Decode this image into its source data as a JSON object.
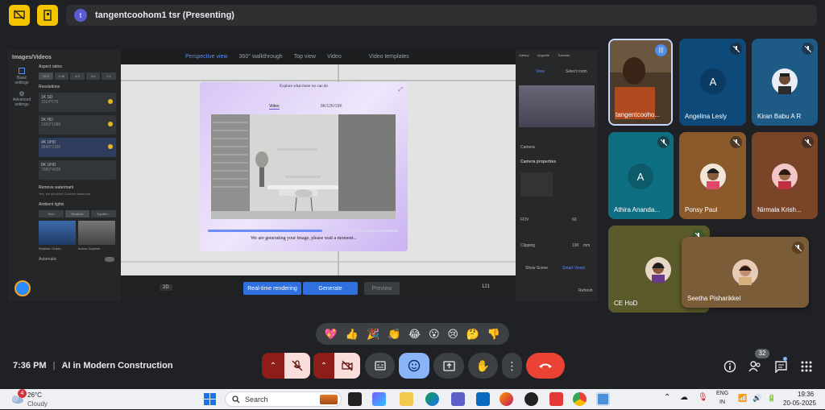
{
  "presenter": {
    "badge": "t",
    "text": "tangentcoohom1 tsr (Presenting)"
  },
  "shared_app": {
    "panel_title": "Images/Videos",
    "nav": [
      {
        "label": "Basic settings"
      },
      {
        "label": "Advanced settings"
      }
    ],
    "aspect_label": "Aspect ratios",
    "aspects": [
      "16:9",
      "9:16",
      "4:3",
      "3:4",
      "1:1"
    ],
    "resolution_label": "Resolutions",
    "resolutions": [
      {
        "name": "1K SD",
        "dims": "1024*576"
      },
      {
        "name": "2K HD",
        "dims": "1920*1080"
      },
      {
        "name": "4K UHD",
        "dims": "3840*2160"
      },
      {
        "name": "8K UHD",
        "dims": "7680*4320"
      }
    ],
    "watermark_label": "Remove watermark",
    "watermark_text": "Yes, we removed Coohom watermar",
    "ambient_label": "Ambient lights",
    "ambient_tabs": [
      "Tech",
      "Realistic",
      "Equilibr..."
    ],
    "thumb_labels": [
      "Realistic Outdo...",
      "Indoor Daytime..."
    ],
    "automatic_label": "Automatic",
    "view_tabs": [
      "Perspective view",
      "360° walkthrough",
      "Top view",
      "Video"
    ],
    "video_templates": "Video templates",
    "top_icons": [
      "Gallery",
      "Upgrade",
      "Tutorials"
    ],
    "right_tabs": [
      "View",
      "Select room"
    ],
    "camera_title": "Camera properties",
    "camera_label": "Camera",
    "fov_label": "FOV",
    "fov_value": "60",
    "clipping_label": "Clipping",
    "clipping_value": "100",
    "clipping_unit": "mm",
    "show_scene": "Show Scene",
    "smart_views": "Smart Views",
    "refresh": "Refresh",
    "bottom_left": "2D",
    "realtime_label": "Real-time rendering",
    "generate_label": "Generate",
    "preview_label": "Preview",
    "zoom": "121"
  },
  "modal": {
    "header": "Explore what more we can do",
    "tabs": [
      "Video",
      "8K/12K/16K"
    ],
    "progress": 0.6,
    "status": "We are generating your image, please wait a moment..."
  },
  "participants": [
    {
      "name": "tangentcooho...",
      "type": "video",
      "speaking": true
    },
    {
      "name": "Angelina Lesly",
      "type": "initial",
      "initial": "A",
      "muted": true
    },
    {
      "name": "Kiran Babu A R",
      "type": "photo",
      "muted": true
    },
    {
      "name": "Athira Ananda...",
      "type": "initial",
      "initial": "A",
      "muted": true
    },
    {
      "name": "Ponsy Paul",
      "type": "photo",
      "muted": true
    },
    {
      "name": "Nirmala Krish...",
      "type": "photo",
      "muted": true
    },
    {
      "name": "CE HoD",
      "type": "photo",
      "muted": true
    },
    {
      "name": "Seetha Pisharikkel",
      "type": "photo",
      "muted": true
    }
  ],
  "reactions": [
    "💖",
    "👍",
    "🎉",
    "👏",
    "😂",
    "😮",
    "😢",
    "🤔",
    "👎"
  ],
  "meeting": {
    "time": "7:36 PM",
    "separator": "|",
    "title": "AI in Modern Construction",
    "people_count": "32"
  },
  "colors": {
    "end_call": "#ea4335",
    "muted_bg": "#f9dedc",
    "accent": "#8ab4f8",
    "tile_blue": "#0d4a7a"
  },
  "taskbar": {
    "weather_temp": "26°C",
    "weather_text": "Cloudy",
    "weather_badge": "4",
    "search_placeholder": "Search",
    "lang": "ENG",
    "region": "IN",
    "time": "19:36",
    "date": "20-05-2025"
  }
}
